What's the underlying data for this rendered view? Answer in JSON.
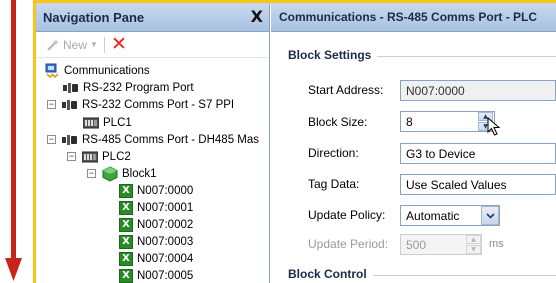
{
  "nav": {
    "title": "Navigation Pane",
    "close_glyph": "X",
    "new_label": "New",
    "tree": [
      {
        "label": "Communications",
        "icon": "communications-icon"
      },
      {
        "label": "RS-232 Program Port",
        "icon": "port-icon"
      },
      {
        "label": "RS-232 Comms Port - S7 PPI",
        "icon": "port-icon"
      },
      {
        "label": "PLC1",
        "icon": "plc-icon"
      },
      {
        "label": "RS-485 Comms Port - DH485 Mas",
        "icon": "port-icon"
      },
      {
        "label": "PLC2",
        "icon": "plc-icon"
      },
      {
        "label": "Block1",
        "icon": "block-icon"
      },
      {
        "label": "N007:0000",
        "icon": "tag-icon"
      },
      {
        "label": "N007:0001",
        "icon": "tag-icon"
      },
      {
        "label": "N007:0002",
        "icon": "tag-icon"
      },
      {
        "label": "N007:0003",
        "icon": "tag-icon"
      },
      {
        "label": "N007:0004",
        "icon": "tag-icon"
      },
      {
        "label": "N007:0005",
        "icon": "tag-icon"
      }
    ],
    "expander_minus": "−"
  },
  "panel": {
    "title": "Communications - RS-485 Comms Port - PLC",
    "block_settings": "Block Settings",
    "block_control": "Block Control",
    "start_address_label": "Start Address:",
    "start_address_value": "N007:0000",
    "block_size_label": "Block Size:",
    "block_size_value": "8",
    "direction_label": "Direction:",
    "direction_value": "G3 to Device",
    "tag_data_label": "Tag Data:",
    "tag_data_value": "Use Scaled Values",
    "update_policy_label": "Update Policy:",
    "update_policy_value": "Automatic",
    "update_period_label": "Update Period:",
    "update_period_value": "500",
    "update_period_unit": "ms"
  },
  "colors": {
    "accent_yellow": "#f5c518",
    "arrow_red": "#c8231c",
    "header_blue": "#a9c1e2"
  }
}
